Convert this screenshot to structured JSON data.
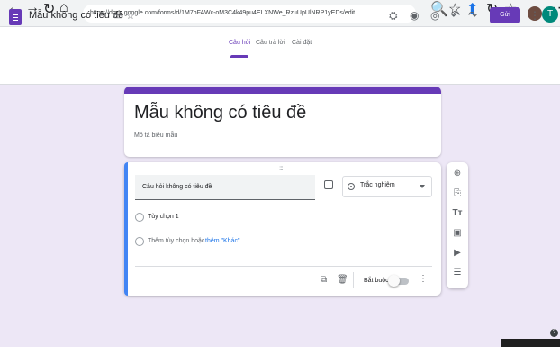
{
  "browser": {
    "url": "https://docs.google.com/forms/d/1M7hFAWc-oM3C4k49pu4ELXNWe_RzuUpUlNRP1yEDs/edit",
    "nav_icons": {
      "back": "←",
      "forward": "→",
      "reload": "↻",
      "home": "⌂",
      "lock": "ⓘ"
    },
    "right_icons": {
      "zoom": "🔍",
      "star": "☆",
      "ext": "⬆",
      "refresh": "↻",
      "collections": "☆"
    },
    "more": "···"
  },
  "forms_header": {
    "title": "Mẫu không có tiêu đề",
    "folder": "▭",
    "star": "☆",
    "send_label": "Gửi",
    "avatar": "T",
    "tools": {
      "palette": "⛭",
      "preview": "◉",
      "eye": "◎",
      "undo": "↶",
      "redo": "↷",
      "more": "⋮"
    },
    "tabs": [
      "Câu hỏi",
      "Câu trả lời",
      "Cài đặt"
    ]
  },
  "form": {
    "title": "Mẫu không có tiêu đề",
    "description": "Mô tả biểu mẫu"
  },
  "question": {
    "drag": ":::",
    "text": "Câu hỏi không có tiêu đề",
    "type": "Trắc nghiệm",
    "option1": "Tùy chọn 1",
    "add_option": "Thêm tùy chọn hoặc",
    "add_other": "thêm \"Khác\"",
    "required_label": "Bắt buộc",
    "required": false,
    "footer_icons": {
      "copy": "⧉",
      "delete": "🗑",
      "more": "⋮"
    }
  },
  "toolbar": {
    "icons": [
      "⊕",
      "⎘",
      "Tт",
      "▣",
      "▶",
      "☰"
    ]
  },
  "colors": {
    "accent": "#673ab7",
    "background": "#ede7f6",
    "question_accent": "#4285f4"
  }
}
